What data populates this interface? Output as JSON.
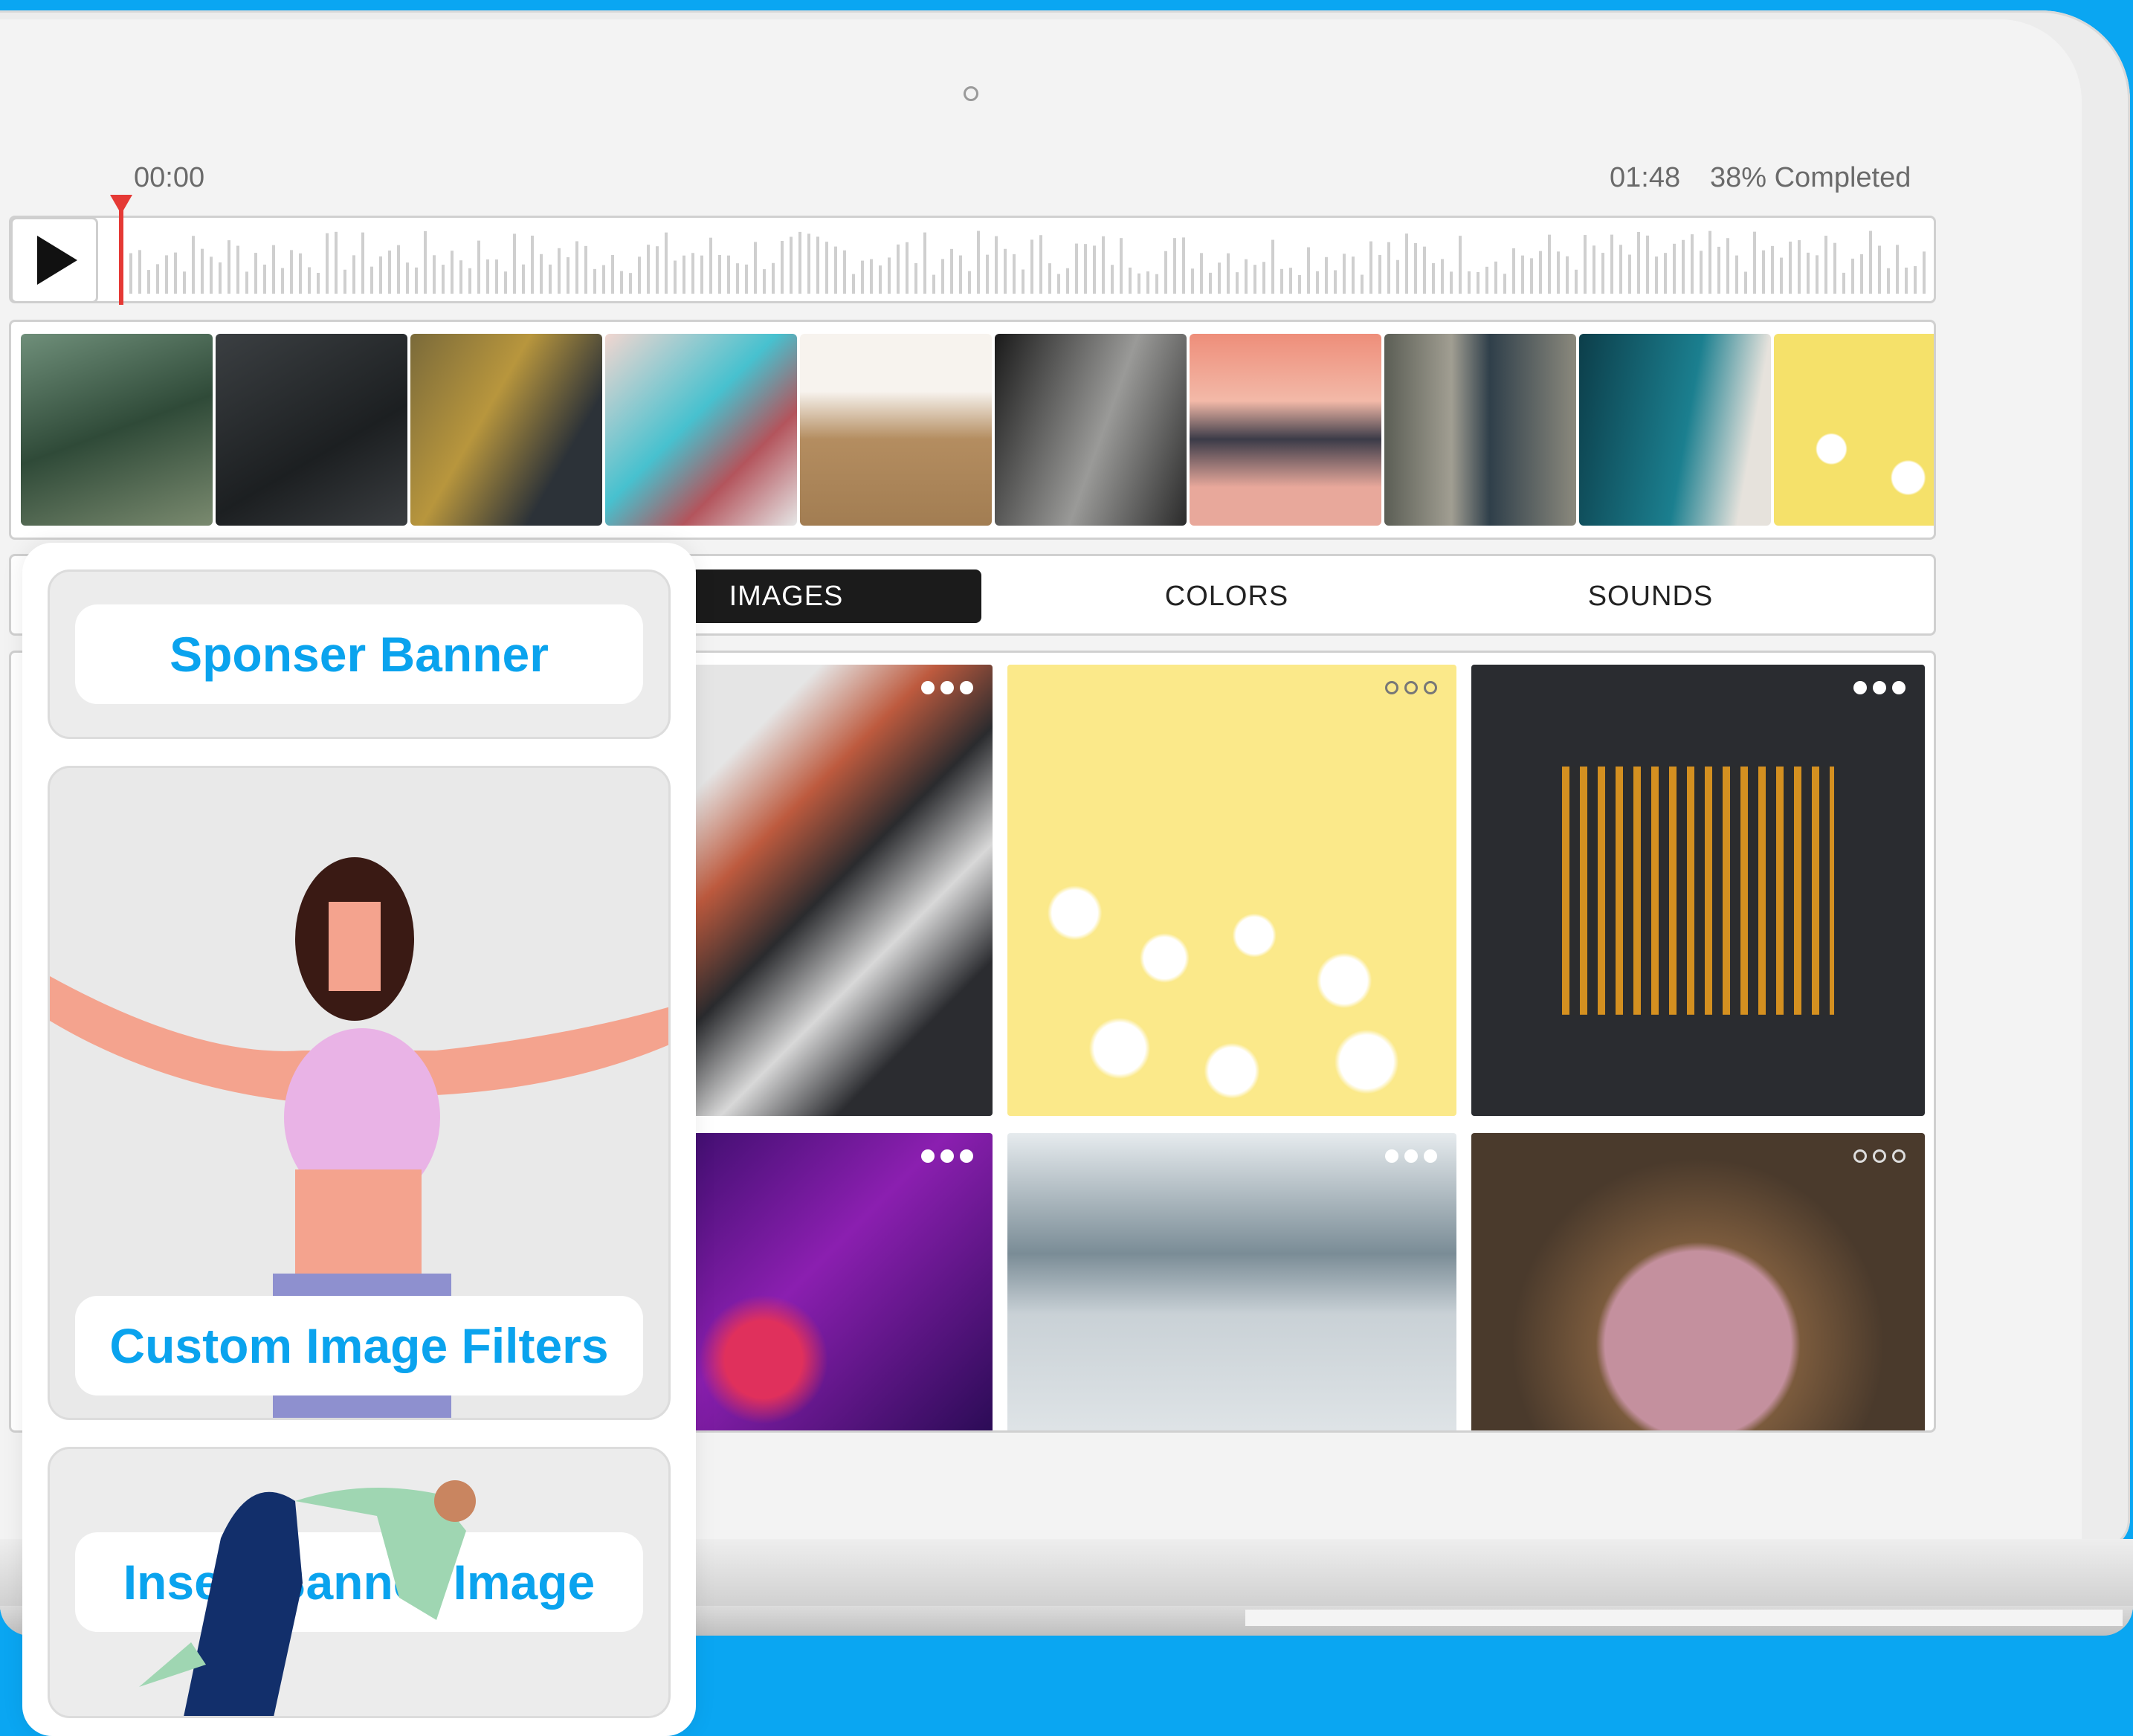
{
  "player": {
    "start_time": "00:00",
    "end_time": "01:48",
    "progress_text": "38% Completed",
    "progress_value": 0.38,
    "play_icon": "play-icon",
    "playhead_color": "#e53935"
  },
  "tabs": [
    {
      "label": "IMAGES",
      "active": true
    },
    {
      "label": "COLORS",
      "active": false
    },
    {
      "label": "SOUNDS",
      "active": false
    }
  ],
  "panel": {
    "sponsor_label": "Sponser Banner",
    "filters_label": "Custom Image Filters",
    "insert_label": "Insert Banner Image"
  },
  "gallery": {
    "more_icon": "more-options-icon",
    "tiles": [
      {
        "subject": "snowy mountain"
      },
      {
        "subject": "fried eggs on yellow"
      },
      {
        "subject": "city crosswalk aerial"
      },
      {
        "subject": "purple jellyfish"
      },
      {
        "subject": "misty lake with boat"
      },
      {
        "subject": "strawberry cake"
      }
    ]
  },
  "colors": {
    "accent": "#0aa6f2",
    "button_text": "#0aa3ee",
    "active_tab": "#1b1b1b"
  }
}
